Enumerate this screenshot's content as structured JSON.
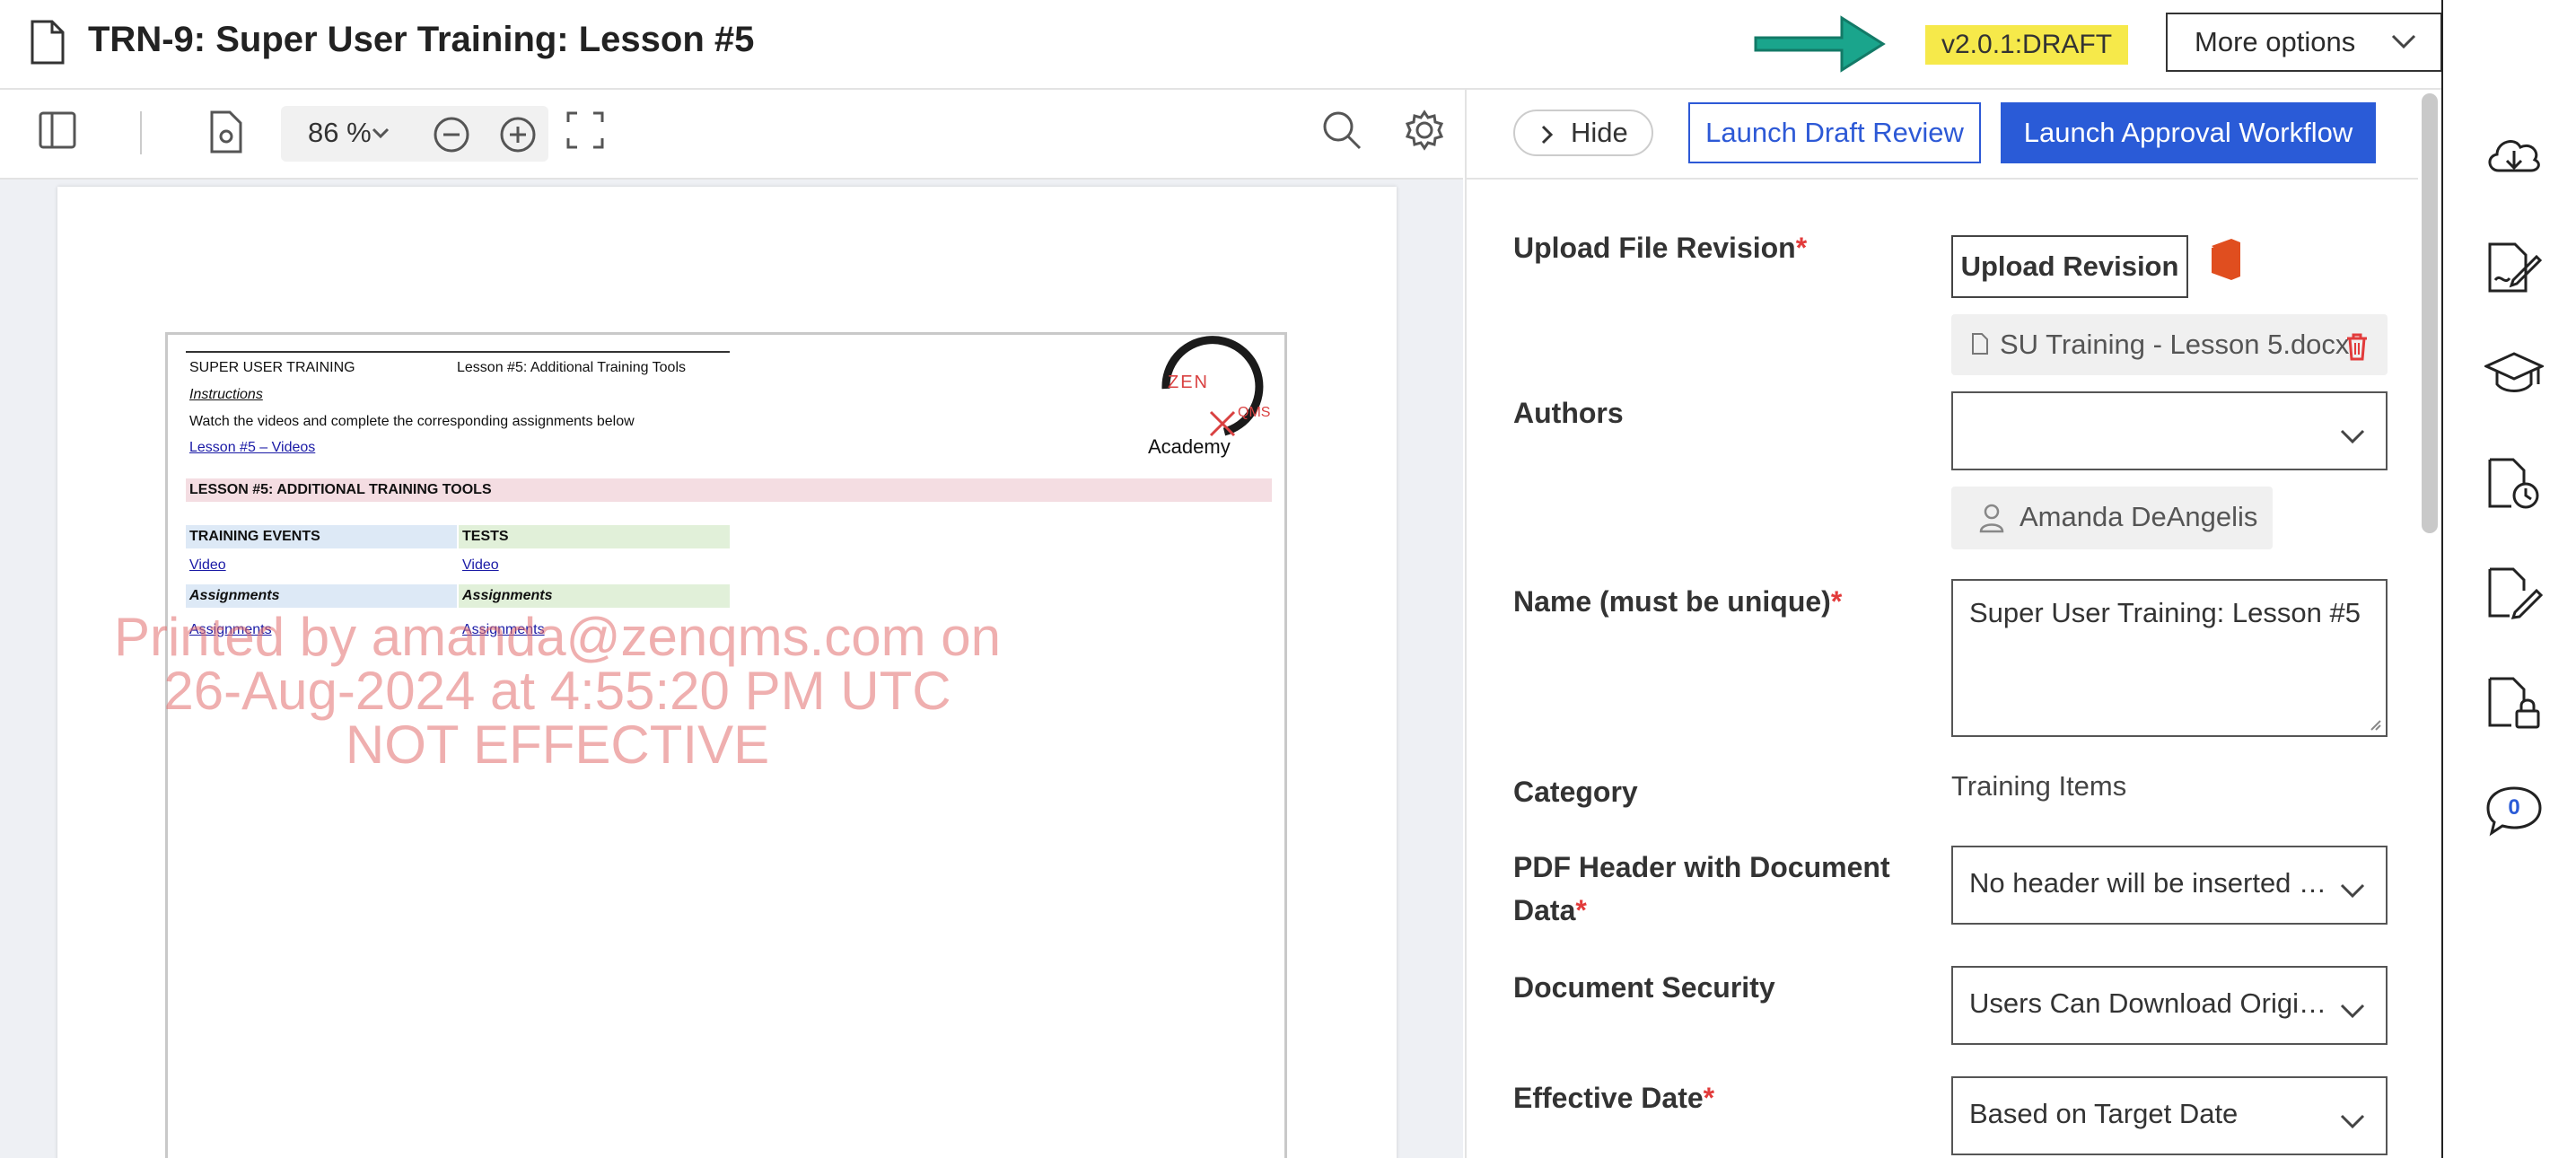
{
  "header": {
    "title": "TRN-9: Super User Training: Lesson #5",
    "version": "v2.0.1:DRAFT",
    "more_options": "More options",
    "accent_color": "#1aa58c",
    "badge_color": "#f6e94a"
  },
  "viewer_toolbar": {
    "zoom": "86 %"
  },
  "document": {
    "header_left": "SUPER USER TRAINING",
    "header_right": "Lesson #5: Additional Training Tools",
    "instructions_heading": "Instructions",
    "instructions_text": "Watch the videos and complete the corresponding assignments below",
    "videos_link": "Lesson #5 – Videos",
    "section_title": "LESSON #5: ADDITIONAL TRAINING TOOLS",
    "col1_header": "TRAINING EVENTS",
    "col2_header": "TESTS",
    "col1_video": "Video",
    "col2_video": "Video",
    "col1_assign_heading": "Assignments",
    "col2_assign_heading": "Assignments",
    "col1_assign_link": "Assignments",
    "col2_assign_link": "Assignments",
    "logo_text": "ZEN",
    "logo_sub": "Academy",
    "logo_qms": "QMS",
    "watermark_line1": "Printed by amanda@zenqms.com on",
    "watermark_line2": "26-Aug-2024 at 4:55:20 PM UTC",
    "watermark_line3": "NOT EFFECTIVE"
  },
  "panel": {
    "hide_label": "Hide",
    "draft_review": "Launch Draft Review",
    "approval": "Launch Approval Workflow",
    "fields": {
      "upload_label": "Upload File Revision",
      "upload_button": "Upload Revision",
      "file_name": "SU Training - Lesson 5.docx",
      "authors_label": "Authors",
      "author_name": "Amanda DeAngelis",
      "name_label": "Name (must be unique)",
      "name_value": "Super User Training: Lesson #5",
      "category_label": "Category",
      "category_value": "Training Items",
      "pdf_header_label_1": "PDF Header with Document",
      "pdf_header_label_2": "Data",
      "pdf_header_value": "No header will be inserted i…",
      "security_label": "Document Security",
      "security_value": "Users Can Download Origi…",
      "effective_label": "Effective Date",
      "effective_value": "Based on Target Date",
      "required_mark": "*"
    }
  },
  "rail": {
    "comment_count": "0"
  }
}
